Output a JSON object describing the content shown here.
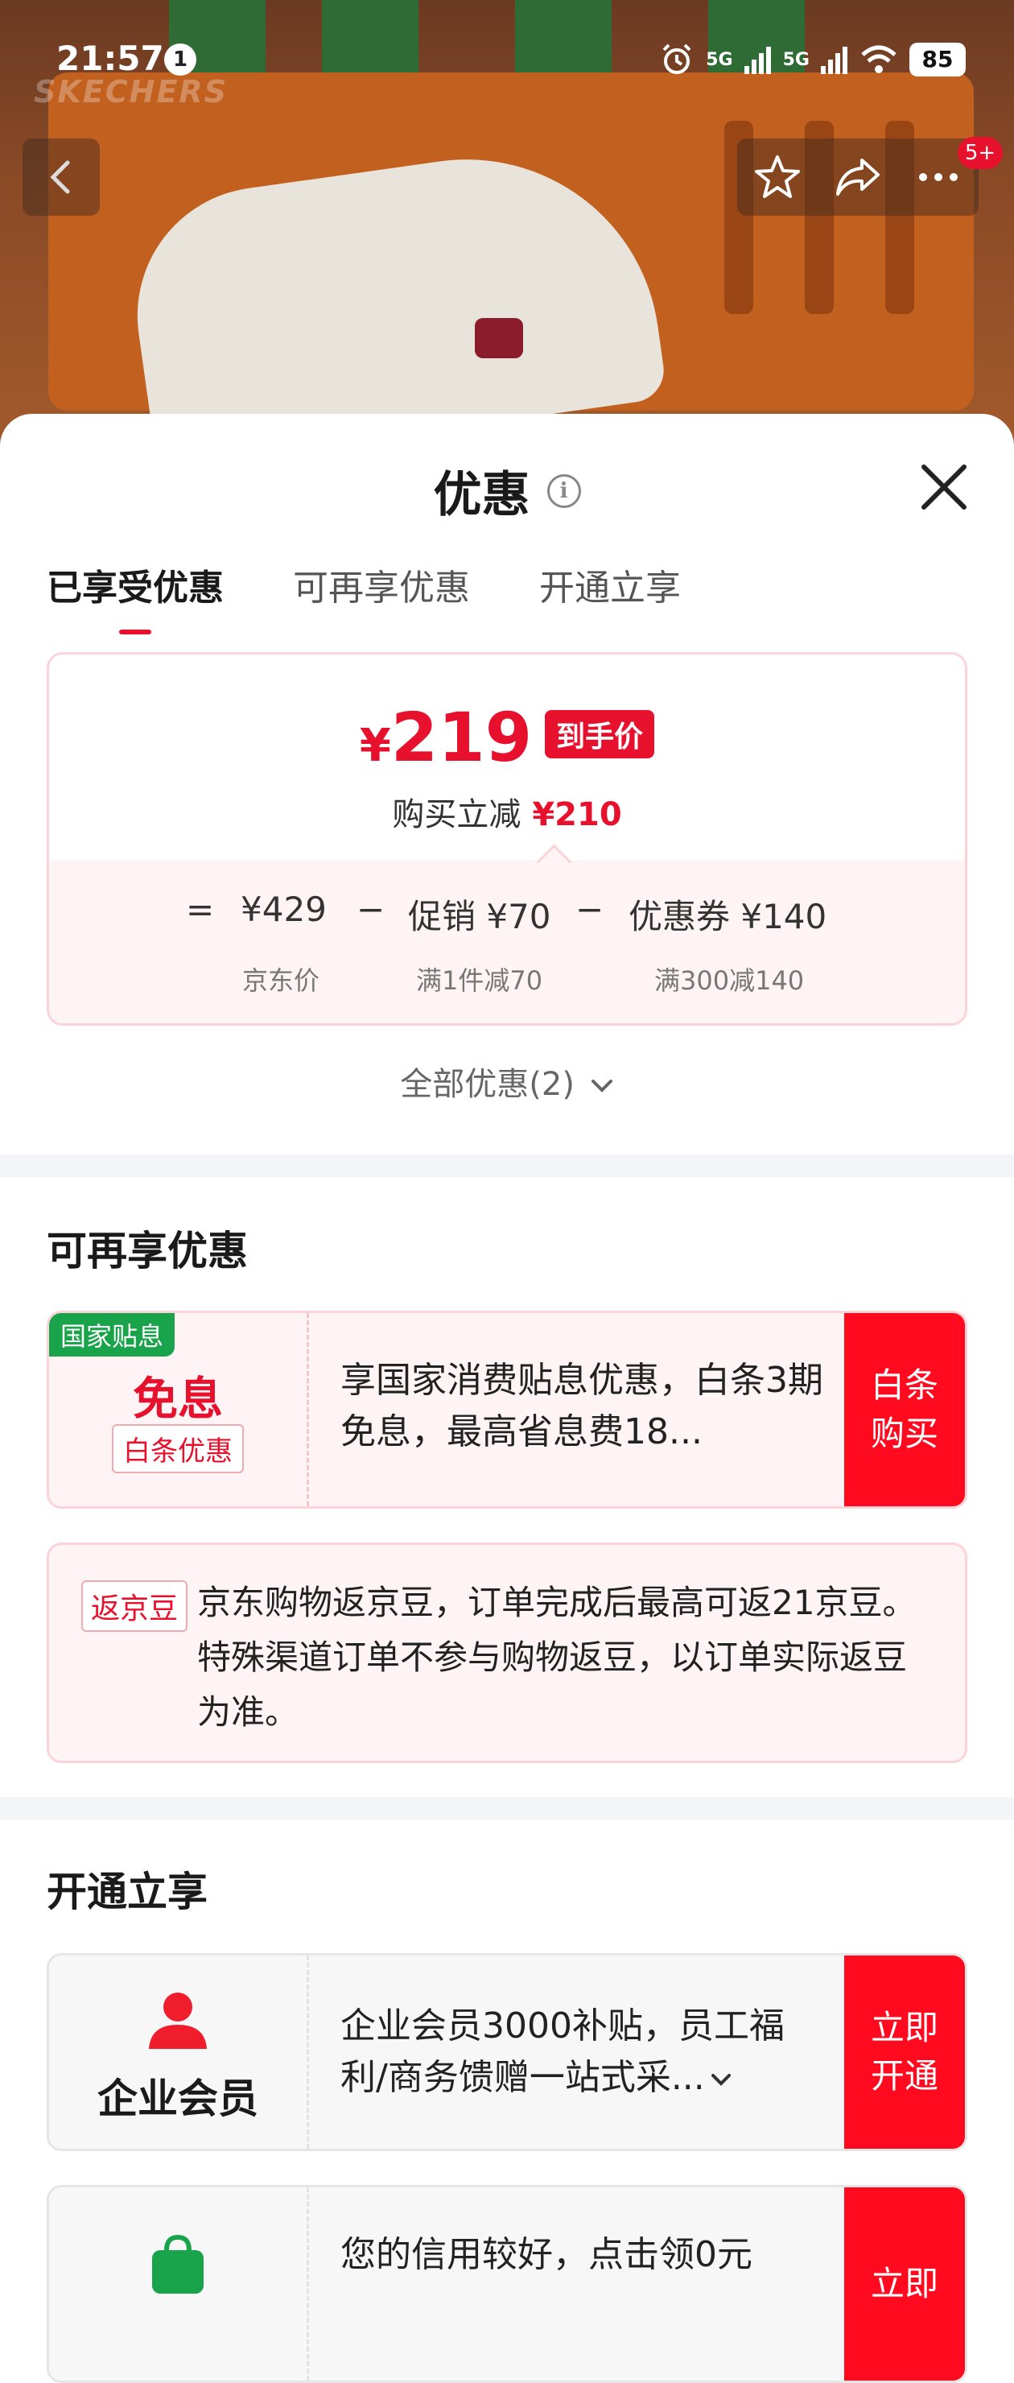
{
  "status_bar": {
    "time": "21:57",
    "notification_count": "1",
    "signal_1": "5G",
    "signal_2": "5G",
    "battery": "85"
  },
  "hero": {
    "brand_watermark": "SKECHERS",
    "cart_badge": "5+"
  },
  "sheet": {
    "title": "优惠",
    "info_icon_glyph": "i",
    "tabs": [
      {
        "label": "已享受优惠",
        "active": true
      },
      {
        "label": "可再享优惠",
        "active": false
      },
      {
        "label": "开通立享",
        "active": false
      }
    ]
  },
  "price_card": {
    "currency": "¥",
    "final_price": "219",
    "final_tag": "到手价",
    "reduce_label": "购买立减",
    "reduce_amount": "¥210",
    "formula": {
      "equals": "=",
      "jd_price": "¥429",
      "minus1": "−",
      "promo": "促销 ¥70",
      "minus2": "−",
      "coupon": "优惠券 ¥140"
    },
    "formula_sub": {
      "jd_price_label": "京东价",
      "promo_rule": "满1件减70",
      "coupon_rule": "满300减140"
    }
  },
  "all_discounts": "全部优惠(2)",
  "section_more": {
    "title": "可再享优惠",
    "interest_card": {
      "corner_tag": "国家贴息",
      "headline": "免息",
      "sub_tag": "白条优惠",
      "description": "享国家消费贴息优惠，白条3期免息，最高省息费18...",
      "button": "白条购买"
    },
    "bean_card": {
      "tag": "返京豆",
      "description": "京东购物返京豆，订单完成后最高可返21京豆。特殊渠道订单不参与购物返豆，以订单实际返豆为准。"
    }
  },
  "section_open": {
    "title": "开通立享",
    "member_card": {
      "label": "企业会员",
      "description": "企业会员3000补贴，员工福利/商务馈赠一站式采...",
      "button": "立即开通"
    },
    "credit_card": {
      "description": "您的信用较好，点击领0元",
      "button": "立即"
    }
  },
  "colors": {
    "accent_red": "#e8112d",
    "button_red": "#ff0a1e",
    "tag_green": "#19a34a",
    "card_pink_bg": "#fff4f5",
    "card_pink_border": "#fbd3d8"
  }
}
